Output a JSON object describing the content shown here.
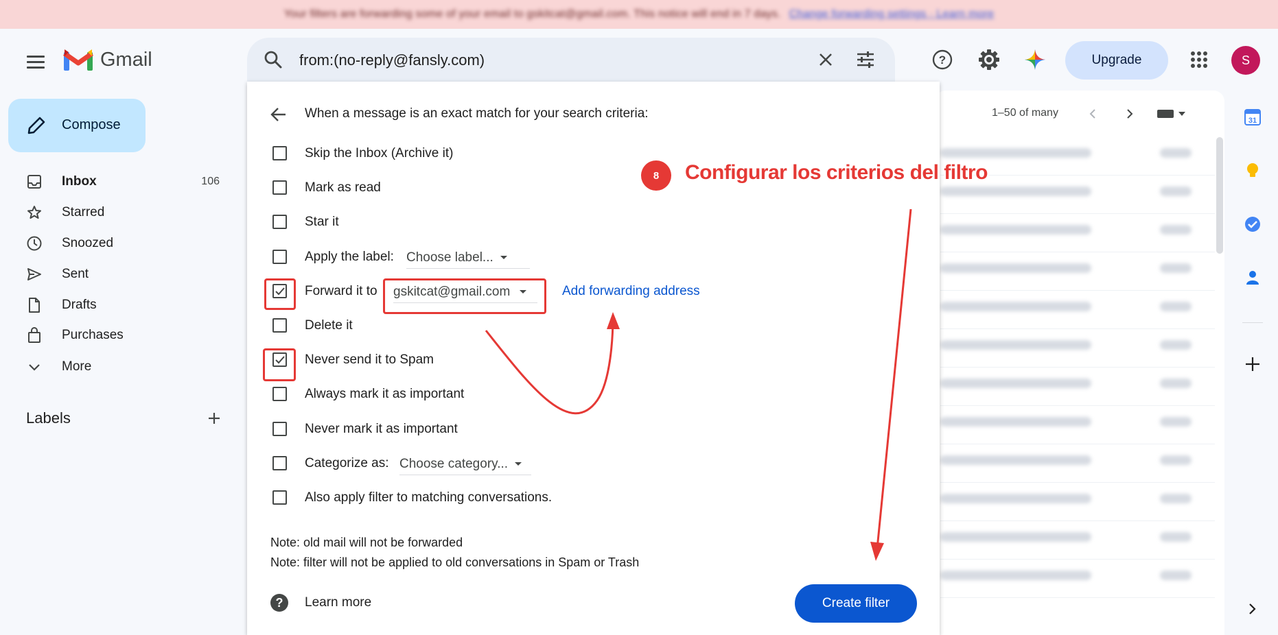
{
  "banner": {
    "text": "Your filters are forwarding some of your email to gskitcat@gmail.com. This notice will end in 7 days.",
    "link": "Change forwarding settings · Learn more"
  },
  "header": {
    "app_name": "Gmail",
    "search_value": "from:(no-reply@fansly.com)",
    "upgrade_label": "Upgrade",
    "avatar_initial": "S",
    "icons": [
      "help-icon",
      "settings-icon",
      "gemini-icon",
      "apps-icon"
    ]
  },
  "sidebar": {
    "compose_label": "Compose",
    "items": [
      {
        "label": "Inbox",
        "count": "106",
        "icon": "inbox-icon"
      },
      {
        "label": "Starred",
        "count": "",
        "icon": "star-icon"
      },
      {
        "label": "Snoozed",
        "count": "",
        "icon": "clock-icon"
      },
      {
        "label": "Sent",
        "count": "",
        "icon": "send-icon"
      },
      {
        "label": "Drafts",
        "count": "",
        "icon": "draft-icon"
      },
      {
        "label": "Purchases",
        "count": "",
        "icon": "shopping-bag-icon"
      },
      {
        "label": "More",
        "count": "",
        "icon": "chevron-down-icon"
      }
    ],
    "labels_title": "Labels"
  },
  "mail_list": {
    "pager": "1–50 of many"
  },
  "filter_dialog": {
    "title": "When a message is an exact match for your search criteria:",
    "options": [
      {
        "label": "Skip the Inbox (Archive it)",
        "checked": false
      },
      {
        "label": "Mark as read",
        "checked": false
      },
      {
        "label": "Star it",
        "checked": false
      },
      {
        "label": "Apply the label:",
        "checked": false
      },
      {
        "label": "Forward it to",
        "checked": true
      },
      {
        "label": "Delete it",
        "checked": false
      },
      {
        "label": "Never send it to Spam",
        "checked": true
      },
      {
        "label": "Always mark it as important",
        "checked": false
      },
      {
        "label": "Never mark it as important",
        "checked": false
      },
      {
        "label": "Categorize as:",
        "checked": false
      },
      {
        "label": "Also apply filter to matching conversations.",
        "checked": false
      }
    ],
    "label_dropdown": "Choose label...",
    "forward_dropdown": "gskitcat@gmail.com",
    "add_forwarding": "Add forwarding address",
    "category_dropdown": "Choose category...",
    "note1": "Note: old mail will not be forwarded",
    "note2": "Note: filter will not be applied to old conversations in Spam or Trash",
    "learn_more": "Learn more",
    "create_button": "Create filter"
  },
  "annotation": {
    "step": "8",
    "text": "Configurar los criterios del filtro",
    "color": "#e53935"
  },
  "colors": {
    "compose_bg": "#c2e7ff",
    "primary": "#0b57d0",
    "avatar": "#c2185b",
    "banner_bg": "#f9d6d6"
  }
}
